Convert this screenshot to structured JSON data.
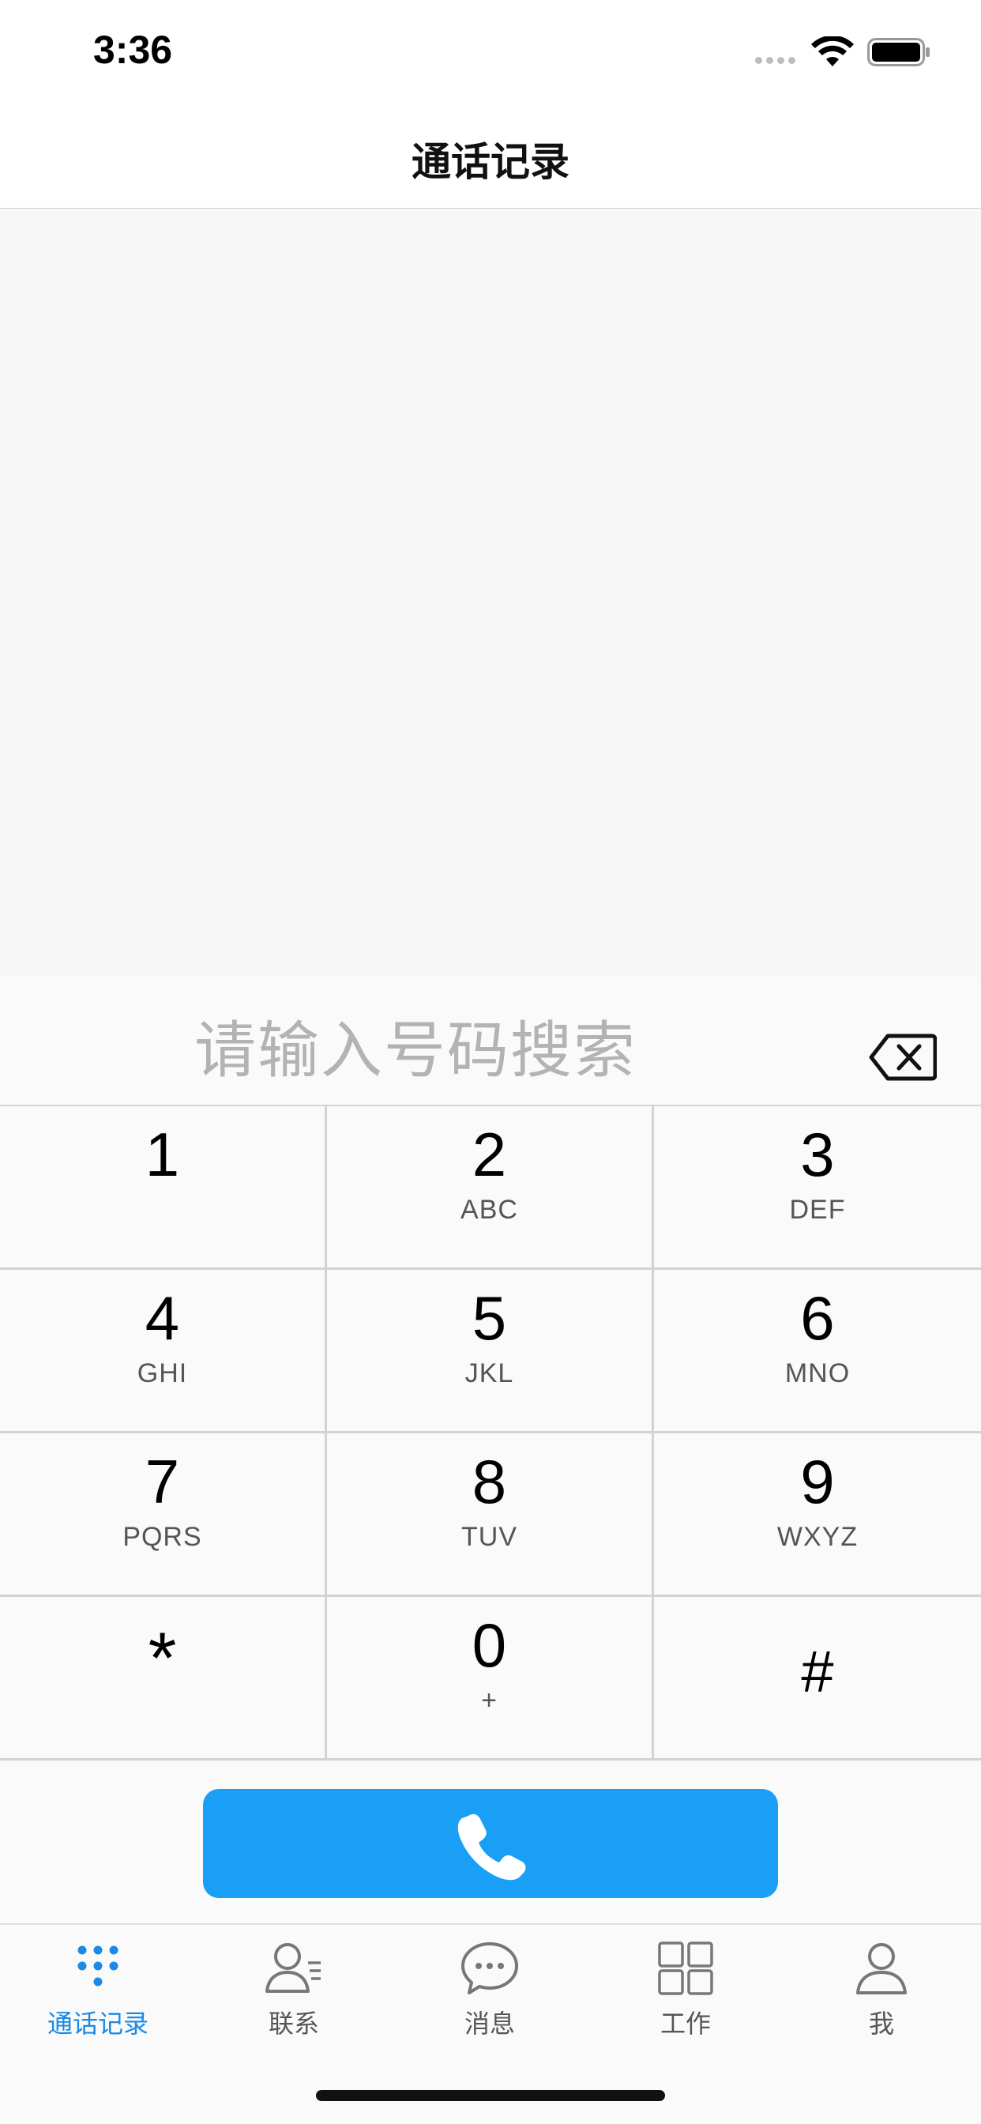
{
  "status_bar": {
    "time": "3:36"
  },
  "nav": {
    "title": "通话记录"
  },
  "dialer": {
    "placeholder": "请输入号码搜索",
    "keys": [
      {
        "digit": "1",
        "letters": ""
      },
      {
        "digit": "2",
        "letters": "ABC"
      },
      {
        "digit": "3",
        "letters": "DEF"
      },
      {
        "digit": "4",
        "letters": "GHI"
      },
      {
        "digit": "5",
        "letters": "JKL"
      },
      {
        "digit": "6",
        "letters": "MNO"
      },
      {
        "digit": "7",
        "letters": "PQRS"
      },
      {
        "digit": "8",
        "letters": "TUV"
      },
      {
        "digit": "9",
        "letters": "WXYZ"
      },
      {
        "digit": "*",
        "letters": ""
      },
      {
        "digit": "0",
        "letters": "+"
      },
      {
        "digit": "#",
        "letters": ""
      }
    ],
    "call_icon": "phone-icon"
  },
  "tabs": [
    {
      "label": "通话记录",
      "icon": "dialpad-icon",
      "active": true
    },
    {
      "label": "联系",
      "icon": "contacts-icon",
      "active": false
    },
    {
      "label": "消息",
      "icon": "chat-bubble-icon",
      "active": false
    },
    {
      "label": "工作",
      "icon": "grid-icon",
      "active": false
    },
    {
      "label": "我",
      "icon": "profile-icon",
      "active": false
    }
  ],
  "colors": {
    "accent": "#1a9ff7",
    "active_tab": "#1a8ae6",
    "placeholder": "#b3b3b3"
  }
}
